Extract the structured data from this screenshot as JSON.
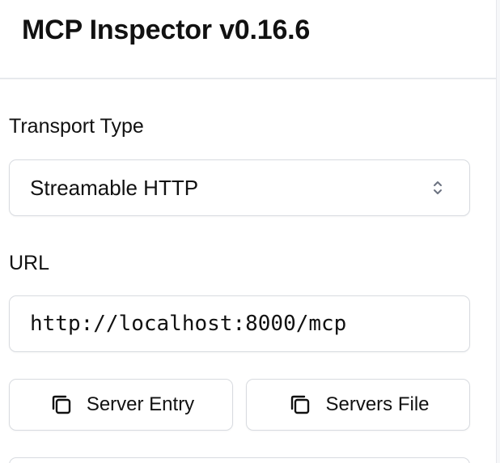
{
  "app": {
    "title": "MCP Inspector v0.16.6"
  },
  "transport": {
    "label": "Transport Type",
    "selected": "Streamable HTTP"
  },
  "url": {
    "label": "URL",
    "value": "http://localhost:8000/mcp"
  },
  "buttons": {
    "server_entry": "Server Entry",
    "servers_file": "Servers File"
  },
  "icons": {
    "select": "chevron-up-down-icon",
    "copy": "copy-icon"
  },
  "colors": {
    "border": "#d8dbe0",
    "text": "#111111",
    "divider": "#e7e9ed"
  }
}
